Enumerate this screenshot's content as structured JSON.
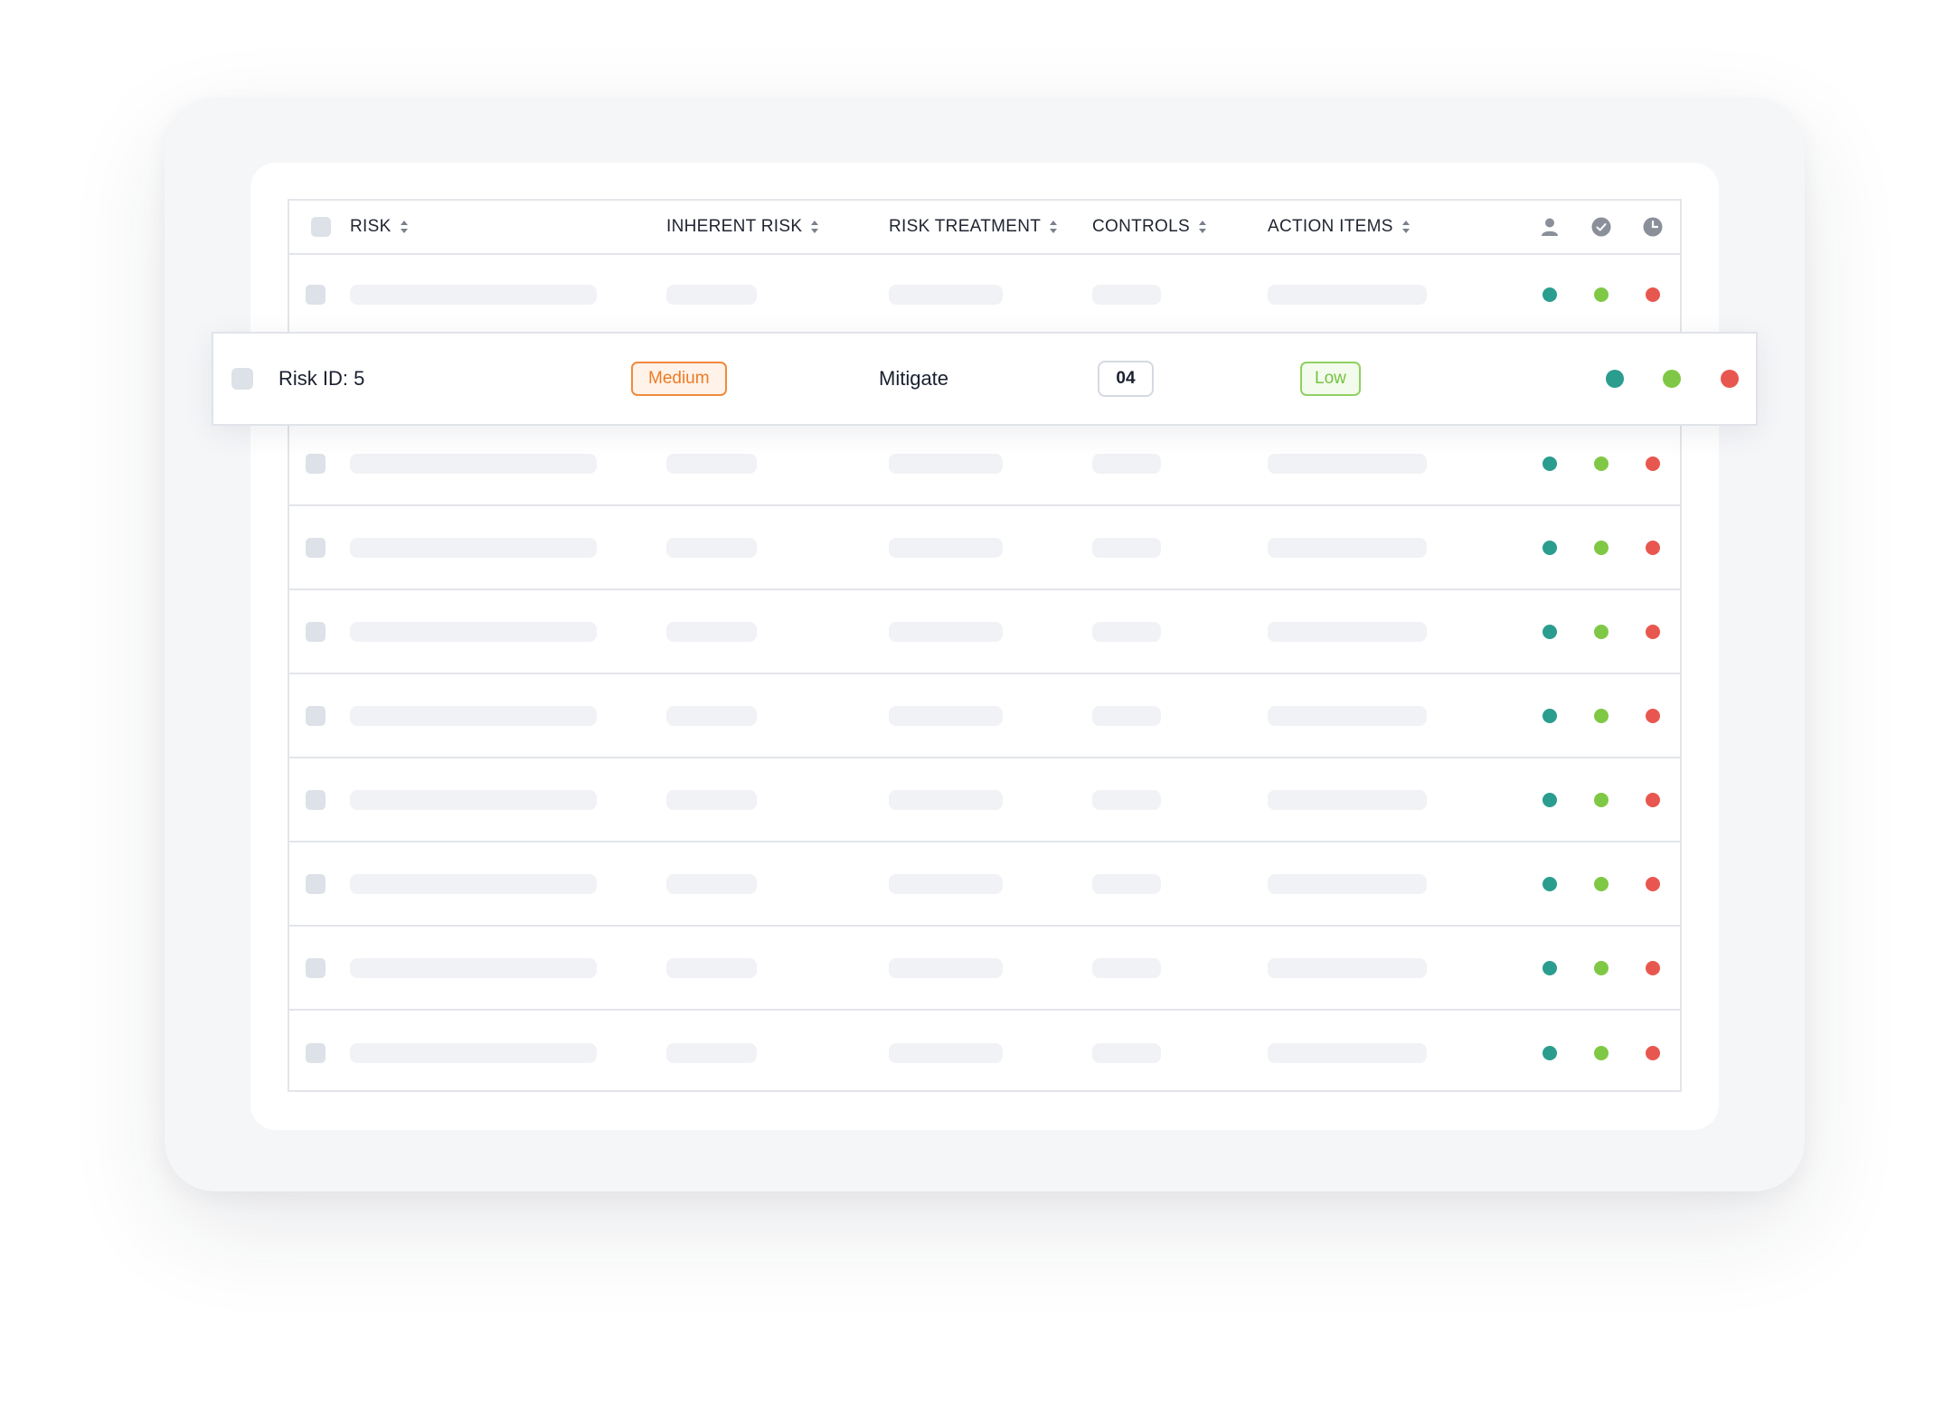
{
  "table": {
    "columns": [
      {
        "label": "RISK",
        "sortable": true
      },
      {
        "label": "INHERENT RISK",
        "sortable": true
      },
      {
        "label": "RISK TREATMENT",
        "sortable": true
      },
      {
        "label": "CONTROLS",
        "sortable": true
      },
      {
        "label": "ACTION ITEMS",
        "sortable": true
      }
    ],
    "header_icons": [
      "user-icon",
      "check-circle-icon",
      "clock-icon"
    ],
    "status_colors": {
      "teal": "#2a9d8f",
      "green": "#7fc845",
      "red": "#e8574f"
    },
    "placeholder_row_count": 9
  },
  "highlighted_row": {
    "risk": "Risk ID: 5",
    "inherent_risk": "Medium",
    "risk_treatment": "Mitigate",
    "controls": "04",
    "action_items": "Low"
  },
  "colors": {
    "medium": "#f07a25",
    "low": "#74c23f"
  }
}
